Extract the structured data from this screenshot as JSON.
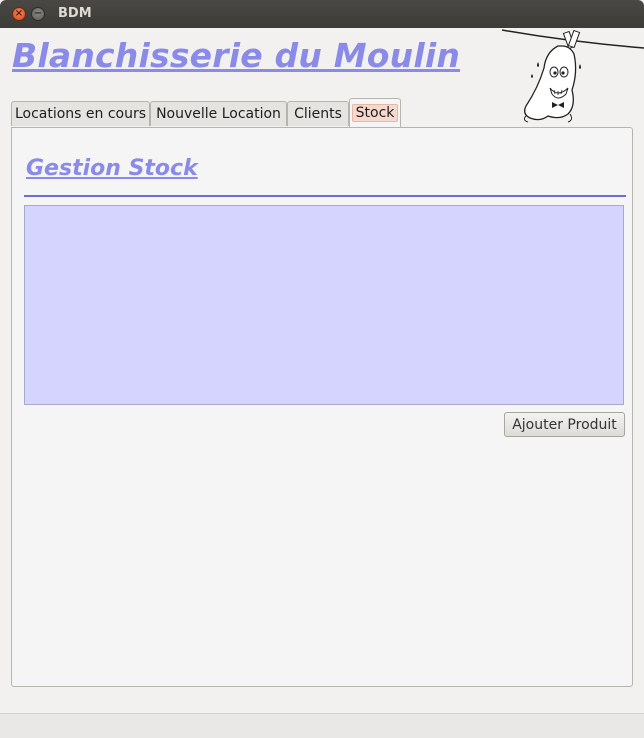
{
  "window": {
    "title": "BDM"
  },
  "app": {
    "title": "Blanchisserie du Moulin"
  },
  "tabs": [
    {
      "label": "Locations en cours"
    },
    {
      "label": "Nouvelle Location"
    },
    {
      "label": "Clients"
    },
    {
      "label": "Stock"
    }
  ],
  "active_tab": "Stock",
  "stock": {
    "section_title": "Gestion Stock",
    "add_button_label": "Ajouter Produit"
  },
  "colors": {
    "title_text": "#8a8ae8",
    "divider": "#6c6cd8",
    "stock_area_bg": "#d4d4ff",
    "active_tab_highlight": "#f7d8cc"
  },
  "icons": {
    "close": "close-icon",
    "minimize": "minimize-icon",
    "mascot": "laundry-mascot-icon"
  }
}
